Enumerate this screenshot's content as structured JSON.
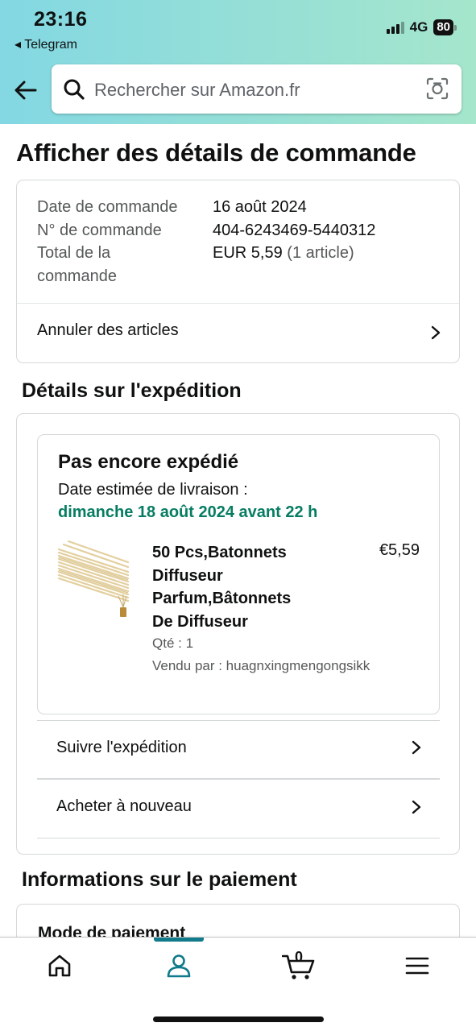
{
  "status_bar": {
    "time": "23:16",
    "back_app": "◂ Telegram",
    "network": "4G",
    "battery": "80"
  },
  "search": {
    "placeholder": "Rechercher sur Amazon.fr"
  },
  "page": {
    "title": "Afficher des détails de commande"
  },
  "order_summary": {
    "rows": [
      {
        "label": "Date de commande",
        "value": "16 août 2024"
      },
      {
        "label": "N° de commande",
        "value": "404-6243469-5440312"
      },
      {
        "label": "Total de la commande",
        "value": "EUR 5,59",
        "value_note": "(1 article)"
      }
    ],
    "label_line1": "Total de la",
    "label_line2": "commande",
    "cancel_link": "Annuler des articles"
  },
  "shipping": {
    "section_title": "Détails sur l'expédition",
    "status": "Pas encore expédié",
    "estimated_label": "Date estimée de livraison :",
    "estimated_date": "dimanche 18 août 2024 avant 22 h",
    "item": {
      "title_lines": [
        "50 Pcs,Batonnets",
        "Diffuseur",
        "Parfum,Bâtonnets",
        "De Diffuseur"
      ],
      "price": "€5,59",
      "quantity": "Qté : 1",
      "seller": "Vendu par : huagnxingmengongsikk"
    },
    "track_link": "Suivre l'expédition",
    "buy_again_link": "Acheter à nouveau"
  },
  "payment": {
    "section_title": "Informations sur le paiement",
    "mode_label": "Mode de paiement"
  },
  "bottom_nav": {
    "cart_count": "0",
    "active_tab": "account",
    "accent_color": "#117a8b"
  },
  "colors": {
    "delivery_green": "#067d62",
    "header_gradient_start": "#83d8e3",
    "header_gradient_end": "#a5e6cc"
  }
}
